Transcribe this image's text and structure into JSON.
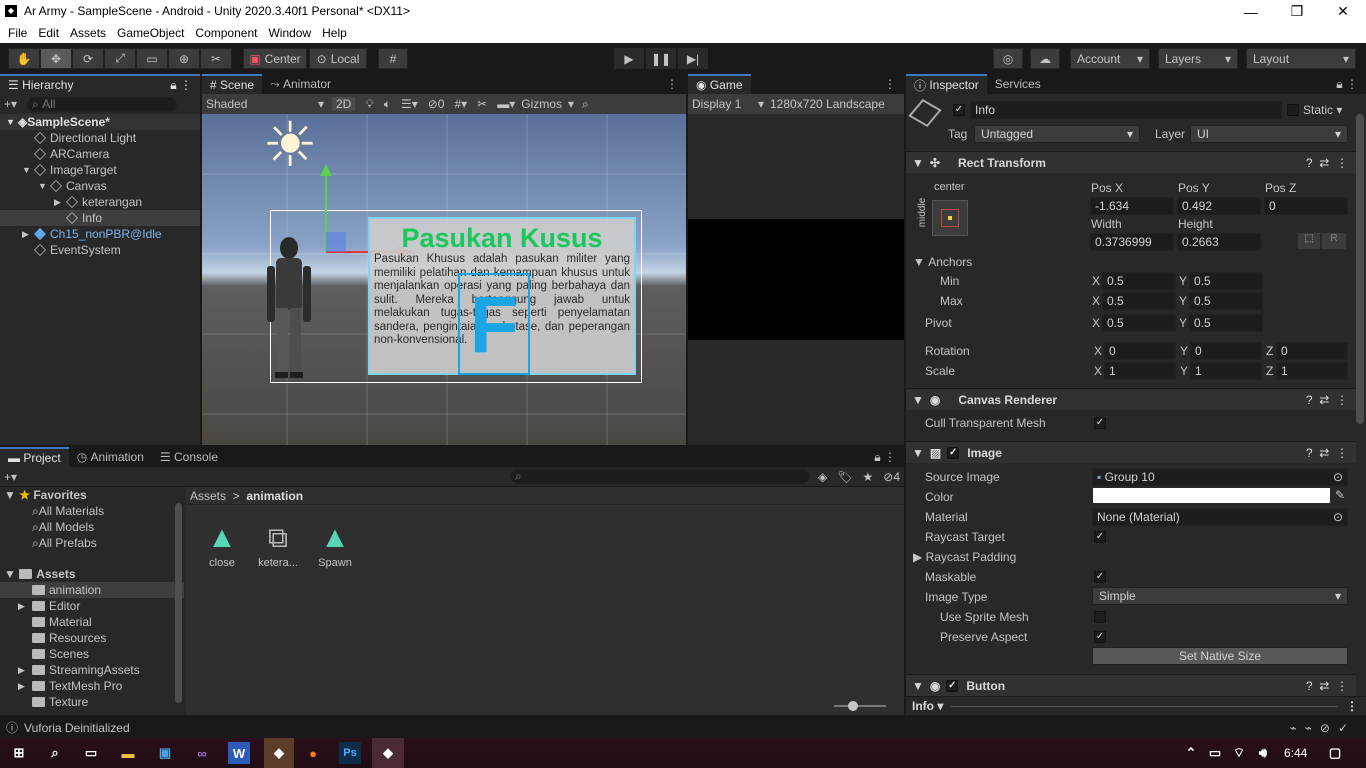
{
  "window": {
    "title": "Ar Army - SampleScene - Android - Unity 2020.3.40f1 Personal* <DX11>"
  },
  "menu": [
    "File",
    "Edit",
    "Assets",
    "GameObject",
    "Component",
    "Window",
    "Help"
  ],
  "toolbar": {
    "center": "Center",
    "local": "Local",
    "account": "Account",
    "layers": "Layers",
    "layout": "Layout"
  },
  "hierarchy": {
    "tab": "Hierarchy",
    "search": "All",
    "items": [
      {
        "label": "SampleScene*",
        "depth": 0,
        "arrow": "▼",
        "kind": "scene",
        "selected": true
      },
      {
        "label": "Directional Light",
        "depth": 1,
        "arrow": "",
        "kind": "obj"
      },
      {
        "label": "ARCamera",
        "depth": 1,
        "arrow": "",
        "kind": "obj"
      },
      {
        "label": "ImageTarget",
        "depth": 1,
        "arrow": "▼",
        "kind": "obj"
      },
      {
        "label": "Canvas",
        "depth": 2,
        "arrow": "▼",
        "kind": "obj"
      },
      {
        "label": "keterangan",
        "depth": 3,
        "arrow": "▶",
        "kind": "obj"
      },
      {
        "label": "Info",
        "depth": 3,
        "arrow": "",
        "kind": "obj",
        "highlight": true
      },
      {
        "label": "Ch15_nonPBR@Idle",
        "depth": 1,
        "arrow": "▶",
        "kind": "prefab"
      },
      {
        "label": "EventSystem",
        "depth": 1,
        "arrow": "",
        "kind": "obj"
      }
    ]
  },
  "scene": {
    "tabs": [
      "Scene",
      "Animator"
    ],
    "shading": "Shaded",
    "mode2d": "2D",
    "hidden": "0",
    "gizmos": "Gizmos",
    "panel_title": "Pasukan Kusus",
    "panel_text": "Pasukan Khusus adalah pasukan militer yang memiliki pelatihan dan kemampuan khusus untuk menjalankan operasi yang paling berbahaya dan sulit. Mereka bertanggung jawab untuk melakukan tugas-tugas seperti penyelamatan sandera, pengintaian, sabotase, dan peperangan non-konvensional."
  },
  "game": {
    "tab": "Game",
    "display": "Display 1",
    "resolution": "1280x720 Landscape"
  },
  "inspector": {
    "tabs": [
      "Inspector",
      "Services"
    ],
    "name": "Info",
    "static": "Static",
    "tag_label": "Tag",
    "tag": "Untagged",
    "layer_label": "Layer",
    "layer": "UI",
    "rect": {
      "title": "Rect Transform",
      "anchor_h": "center",
      "anchor_v": "middle",
      "posx_l": "Pos X",
      "posy_l": "Pos Y",
      "posz_l": "Pos Z",
      "posx": "-1.634",
      "posy": "0.492",
      "posz": "0",
      "width_l": "Width",
      "height_l": "Height",
      "width": "0.3736999",
      "height": "0.2663",
      "anchors": "Anchors",
      "min": "Min",
      "max": "Max",
      "pivot": "Pivot",
      "rotation": "Rotation",
      "scale": "Scale",
      "min_x": "0.5",
      "min_y": "0.5",
      "max_x": "0.5",
      "max_y": "0.5",
      "pivot_x": "0.5",
      "pivot_y": "0.5",
      "rot_x": "0",
      "rot_y": "0",
      "rot_z": "0",
      "sc_x": "1",
      "sc_y": "1",
      "sc_z": "1",
      "r_btn": "R"
    },
    "canvas_renderer": {
      "title": "Canvas Renderer",
      "cull": "Cull Transparent Mesh"
    },
    "image": {
      "title": "Image",
      "source_l": "Source Image",
      "source": "Group 10",
      "color_l": "Color",
      "material_l": "Material",
      "material": "None (Material)",
      "raycast_l": "Raycast Target",
      "padding_l": "Raycast Padding",
      "maskable_l": "Maskable",
      "type_l": "Image Type",
      "type": "Simple",
      "sprite_mesh_l": "Use Sprite Mesh",
      "aspect_l": "Preserve Aspect",
      "native": "Set Native Size"
    },
    "button": {
      "title": "Button"
    },
    "footer": "Info"
  },
  "project": {
    "tabs": [
      "Project",
      "Animation",
      "Console"
    ],
    "hidden_count": "4",
    "favorites": "Favorites",
    "fav_items": [
      "All Materials",
      "All Models",
      "All Prefabs"
    ],
    "assets": "Assets",
    "folders": [
      {
        "label": "animation",
        "arrow": "",
        "sel": true
      },
      {
        "label": "Editor",
        "arrow": "▶"
      },
      {
        "label": "Material",
        "arrow": ""
      },
      {
        "label": "Resources",
        "arrow": ""
      },
      {
        "label": "Scenes",
        "arrow": ""
      },
      {
        "label": "StreamingAssets",
        "arrow": "▶"
      },
      {
        "label": "TextMesh Pro",
        "arrow": "▶"
      },
      {
        "label": "Texture",
        "arrow": ""
      }
    ],
    "breadcrumb": [
      "Assets",
      "animation"
    ],
    "files": [
      "close",
      "ketera...",
      "Spawn"
    ]
  },
  "status": {
    "text": "Vuforia Deinitialized"
  },
  "taskbar": {
    "time": "6:44"
  }
}
